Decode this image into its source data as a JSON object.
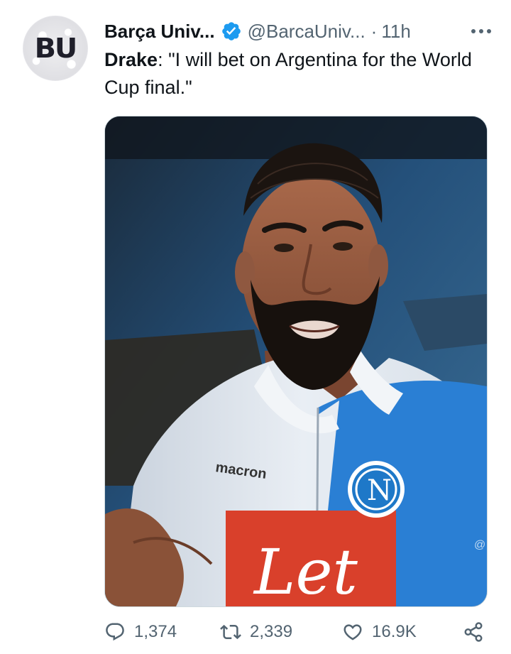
{
  "tweet": {
    "display_name": "Barça Univ...",
    "handle": "@BarcaUniv...",
    "separator": "·",
    "time": "11h",
    "avatar_text": "BU",
    "text_bold": "Drake",
    "text_rest": ": \"I will bet on Argentina for the World Cup final.\"",
    "media": {
      "jacket_brand": "macron",
      "badge_letter": "N",
      "sponsor_text": "Let",
      "corner_mark": "@"
    },
    "actions": {
      "replies": "1,374",
      "retweets": "2,339",
      "likes": "16.9K"
    },
    "icons": {
      "verified": "verified-badge-icon",
      "more": "more-options-icon",
      "reply": "reply-icon",
      "retweet": "retweet-icon",
      "like": "like-icon",
      "share": "share-icon"
    },
    "colors": {
      "verified_blue": "#1d9bf0",
      "secondary_text": "#536471",
      "primary_text": "#0f1419"
    }
  }
}
